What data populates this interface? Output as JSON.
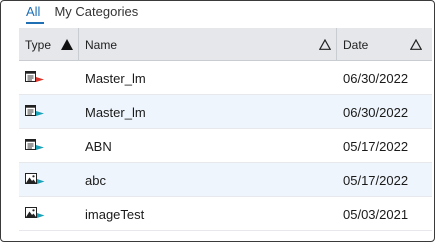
{
  "tabs": [
    {
      "label": "All",
      "active": true
    },
    {
      "label": "My Categories",
      "active": false
    }
  ],
  "columns": {
    "type": "Type",
    "name": "Name",
    "date": "Date"
  },
  "rows": [
    {
      "type_icon": "report-icon-red-flag",
      "name": "Master_lm",
      "date": "06/30/2022"
    },
    {
      "type_icon": "report-icon-teal-flag",
      "name": "Master_lm",
      "date": "06/30/2022"
    },
    {
      "type_icon": "report-icon-teal-flag",
      "name": "ABN",
      "date": "05/17/2022"
    },
    {
      "type_icon": "image-icon-teal-flag",
      "name": "abc",
      "date": "05/17/2022"
    },
    {
      "type_icon": "image-icon-teal-flag",
      "name": "imageTest",
      "date": "05/03/2021"
    }
  ],
  "colors": {
    "accent": "#1f6fb5",
    "header_bg": "#e5e7ea",
    "row_alt_bg": "#eef5fc",
    "flag_red": "#d9342b",
    "flag_teal": "#1aa3b8"
  }
}
